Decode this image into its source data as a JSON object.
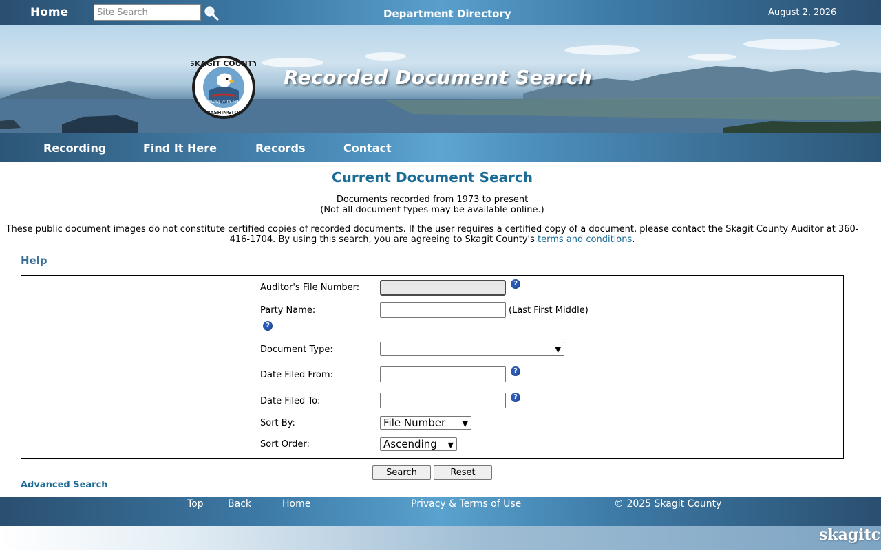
{
  "topbar": {
    "home": "Home",
    "search_placeholder": "Site Search",
    "department_directory": "Department Directory",
    "date": "August 2, 2026"
  },
  "banner": {
    "title": "Recorded Document Search",
    "seal_top": "SKAGIT COUNTY",
    "seal_motto": "Serving With Pride",
    "seal_bottom": "WASHINGTON"
  },
  "nav": {
    "items": [
      "Recording",
      "Find It Here",
      "Records",
      "Contact"
    ]
  },
  "main": {
    "heading": "Current Document Search",
    "range_line": "Documents recorded from 1973 to present",
    "availability_line": "(Not all document types may be available online.)",
    "notice_text_1": "These public document images do not constitute certified copies of recorded documents. If the user requires a certified copy of a document, please contact the Skagit County Auditor at 360-416-1704. By using this search, you are agreeing to Skagit County's ",
    "terms_link": "terms and conditions",
    "notice_end": ".",
    "help": "Help"
  },
  "form": {
    "auditors_file_number_label": "Auditor's File Number:",
    "party_name_label": "Party Name:",
    "party_name_hint": "(Last First Middle)",
    "document_type_label": "Document Type:",
    "document_type_value": "",
    "date_from_label": "Date Filed From:",
    "date_to_label": "Date Filed To:",
    "sort_by_label": "Sort By:",
    "sort_by_value": "File Number",
    "sort_order_label": "Sort Order:",
    "sort_order_value": "Ascending",
    "search_button": "Search",
    "reset_button": "Reset",
    "advanced_search": "Advanced Search"
  },
  "footer": {
    "top": "Top",
    "back": "Back",
    "home": "Home",
    "privacy": "Privacy & Terms of Use",
    "copyright": "© 2025 Skagit County",
    "brand": "skagitco"
  },
  "colors": {
    "heading_blue": "#1b6b97",
    "help_blue": "#3a6f99",
    "help_icon": "#2a5bb5"
  }
}
